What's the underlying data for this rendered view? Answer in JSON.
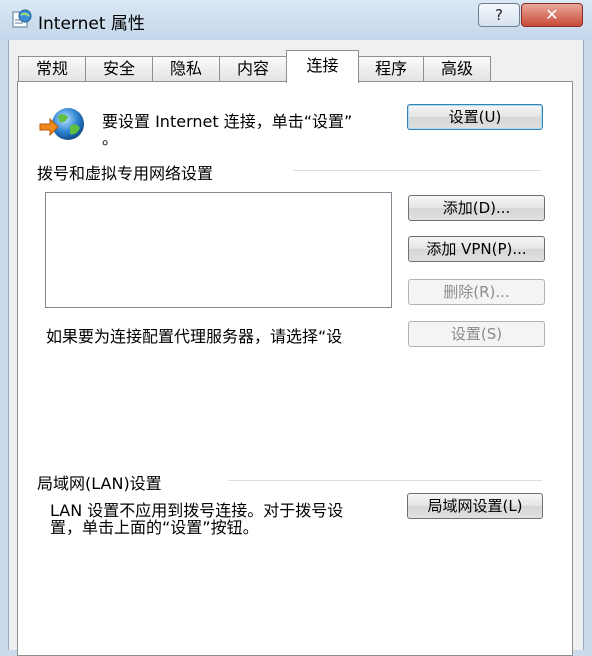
{
  "window": {
    "title": "Internet 属性",
    "help_label": "?",
    "close_label": "✕"
  },
  "tabs": [
    {
      "label": "常规",
      "active": false
    },
    {
      "label": "安全",
      "active": false
    },
    {
      "label": "隐私",
      "active": false
    },
    {
      "label": "内容",
      "active": false
    },
    {
      "label": "连接",
      "active": true
    },
    {
      "label": "程序",
      "active": false
    },
    {
      "label": "高级",
      "active": false
    }
  ],
  "setup": {
    "text_line1": "要设置 Internet 连接，单击“设置”",
    "text_line2": "。",
    "button": "设置(U)"
  },
  "dialup": {
    "heading": "拨号和虚拟专用网络设置",
    "add_button": "添加(D)...",
    "add_vpn_button": "添加 VPN(P)...",
    "remove_button": "删除(R)...",
    "settings_button": "设置(S)",
    "proxy_text": "如果要为连接配置代理服务器，请选择“设"
  },
  "lan": {
    "heading": "局域网(LAN)设置",
    "text_line1": "LAN 设置不应用到拨号连接。对于拨号设",
    "text_line2": "置，单击上面的“设置”按钮。",
    "button": "局域网设置(L)"
  },
  "colors": {
    "titlebar": "#c9daea",
    "default_button_border": "#3c7fb1"
  }
}
